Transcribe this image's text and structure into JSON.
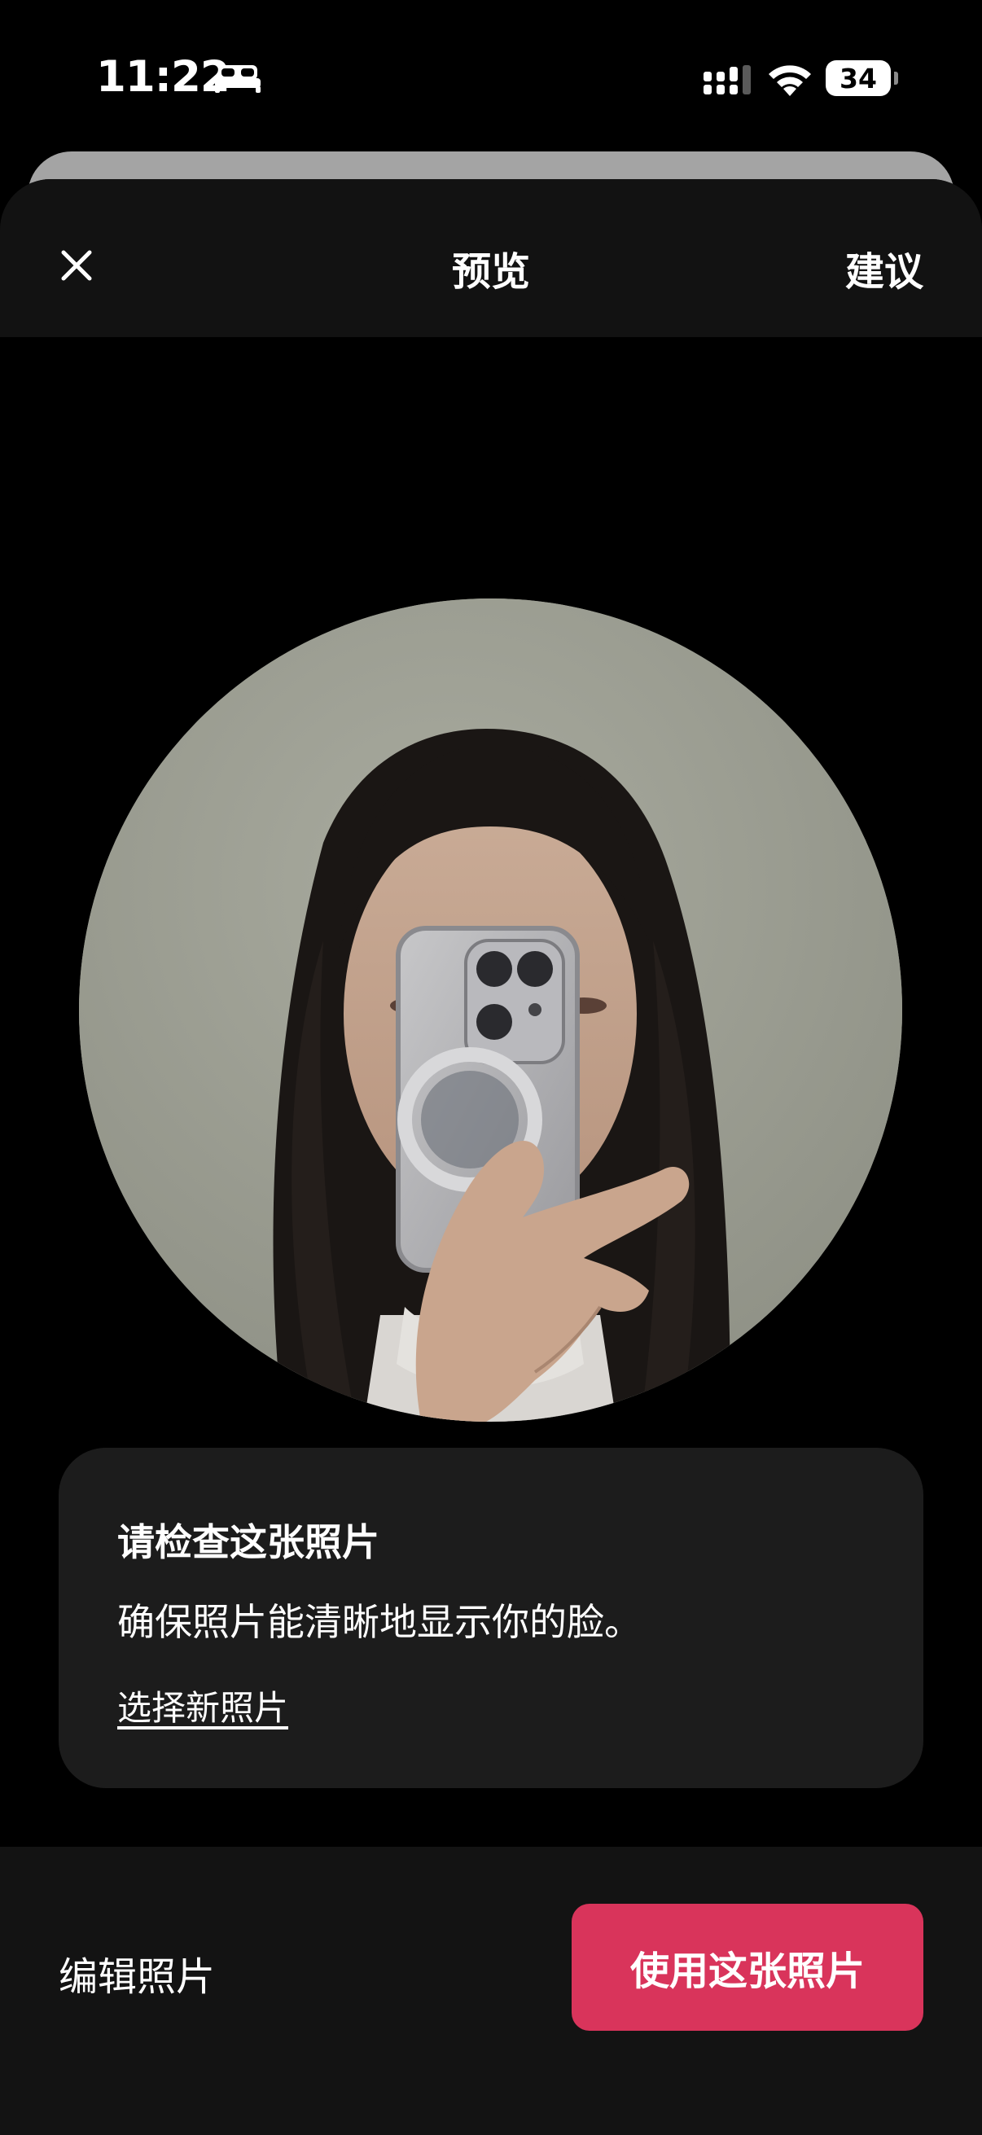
{
  "status_bar": {
    "time": "11:22",
    "battery_level": "34",
    "icons": [
      "bed-icon",
      "cellular-signal-icon",
      "wifi-icon",
      "battery-icon"
    ]
  },
  "header": {
    "title": "预览",
    "action_label": "建议",
    "close_icon": "close-icon"
  },
  "info_card": {
    "title": "请检查这张照片",
    "description": "确保照片能清晰地显示你的脸。",
    "link_label": "选择新照片"
  },
  "footer": {
    "edit_label": "编辑照片",
    "primary_label": "使用这张照片"
  },
  "colors": {
    "background": "#000000",
    "sheet_header": "#121212",
    "card": "#1c1c1c",
    "footer": "#131313",
    "accent": "#d9345b"
  }
}
